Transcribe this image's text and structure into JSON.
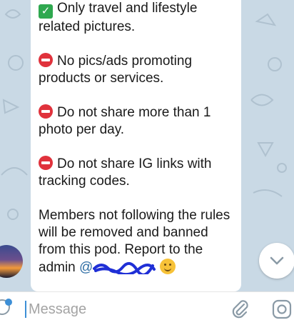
{
  "message": {
    "rules": [
      {
        "icon": "check-mark-button-emoji",
        "text": "Only travel and lifestyle related pictures."
      },
      {
        "icon": "no-entry-emoji",
        "text": "No pics/ads promoting products or services."
      },
      {
        "icon": "no-entry-emoji",
        "text": "Do not share more than 1 photo per day."
      },
      {
        "icon": "no-entry-emoji",
        "text": "Do not share IG links with tracking codes."
      }
    ],
    "closing": "Members not following the rules will be removed and banned from this pod. Report to the admin",
    "mention": "@"
  },
  "composer": {
    "placeholder": "Message"
  },
  "colors": {
    "chat_background": "#c9d9e5",
    "bubble": "#ffffff",
    "accent": "#3d8fd6"
  }
}
